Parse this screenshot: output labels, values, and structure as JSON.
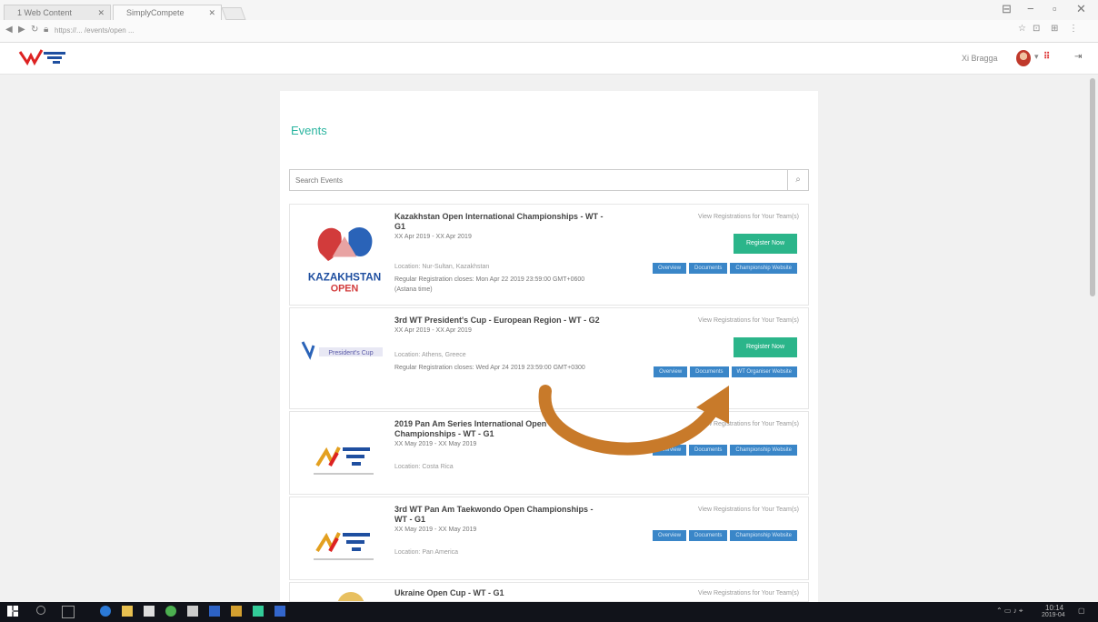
{
  "browser": {
    "tabs": [
      {
        "label": "1 Web Content"
      },
      {
        "label": "SimplyCompete"
      }
    ],
    "url": "https://... /events/open ...",
    "window_controls": [
      "⊟",
      "−",
      "▫",
      "✕"
    ]
  },
  "header": {
    "user_name": "Xi Bragga",
    "flag_label": "⠿",
    "signout_icon": "⇥"
  },
  "panel": {
    "title": "Events",
    "search_placeholder": "Search Events",
    "view_registrations_label": "View Registrations for Your Team(s)",
    "register_label": "Register Now",
    "events": [
      {
        "name": "Kazakhstan Open International Championships - WT - G1",
        "date": "XX Apr 2019 - XX Apr 2019",
        "location": "Location: Nur-Sultan, Kazakhstan",
        "reg_note": "Regular Registration closes: Mon Apr 22 2019 23:59:00 GMT+0600 (Astana time)",
        "has_register": true,
        "buttons": [
          "Overview",
          "Documents",
          "Championship Website"
        ],
        "logo_lines": [
          "KAZAKHSTAN",
          "OPEN"
        ]
      },
      {
        "name": "3rd WT President's Cup - European Region - WT - G2",
        "date": "XX Apr 2019 - XX Apr 2019",
        "location": "Location: Athens, Greece",
        "reg_note": "Regular Registration closes: Wed Apr 24 2019 23:59:00 GMT+0300",
        "has_register": true,
        "buttons": [
          "Overview",
          "Documents",
          "WT Organiser Website"
        ],
        "logo_lines": [
          "President's Cup"
        ]
      },
      {
        "name": "2019 Pan Am Series International Open Championships - WT - G1",
        "date": "XX May 2019 - XX May 2019",
        "location": "Location: Costa Rica",
        "reg_note": "",
        "has_register": false,
        "buttons": [
          "Overview",
          "Documents",
          "Championship Website"
        ],
        "logo_lines": []
      },
      {
        "name": "3rd WT Pan Am Taekwondo Open Championships - WT - G1",
        "date": "XX May 2019 - XX May 2019",
        "location": "Location: Pan America",
        "reg_note": "",
        "has_register": false,
        "buttons": [
          "Overview",
          "Documents",
          "Championship Website"
        ],
        "logo_lines": []
      },
      {
        "name": "Ukraine Open Cup - WT - G1",
        "date": "",
        "location": "",
        "reg_note": "",
        "has_register": false,
        "buttons": [],
        "logo_lines": []
      }
    ]
  },
  "taskbar": {
    "tray_time": "10:14",
    "tray_date": "2019-04"
  },
  "colors": {
    "accent_green": "#2bb58a",
    "button_blue": "#3a86c8",
    "title_teal": "#2bb5a0",
    "annotation_arrow": "#c87a2a"
  }
}
